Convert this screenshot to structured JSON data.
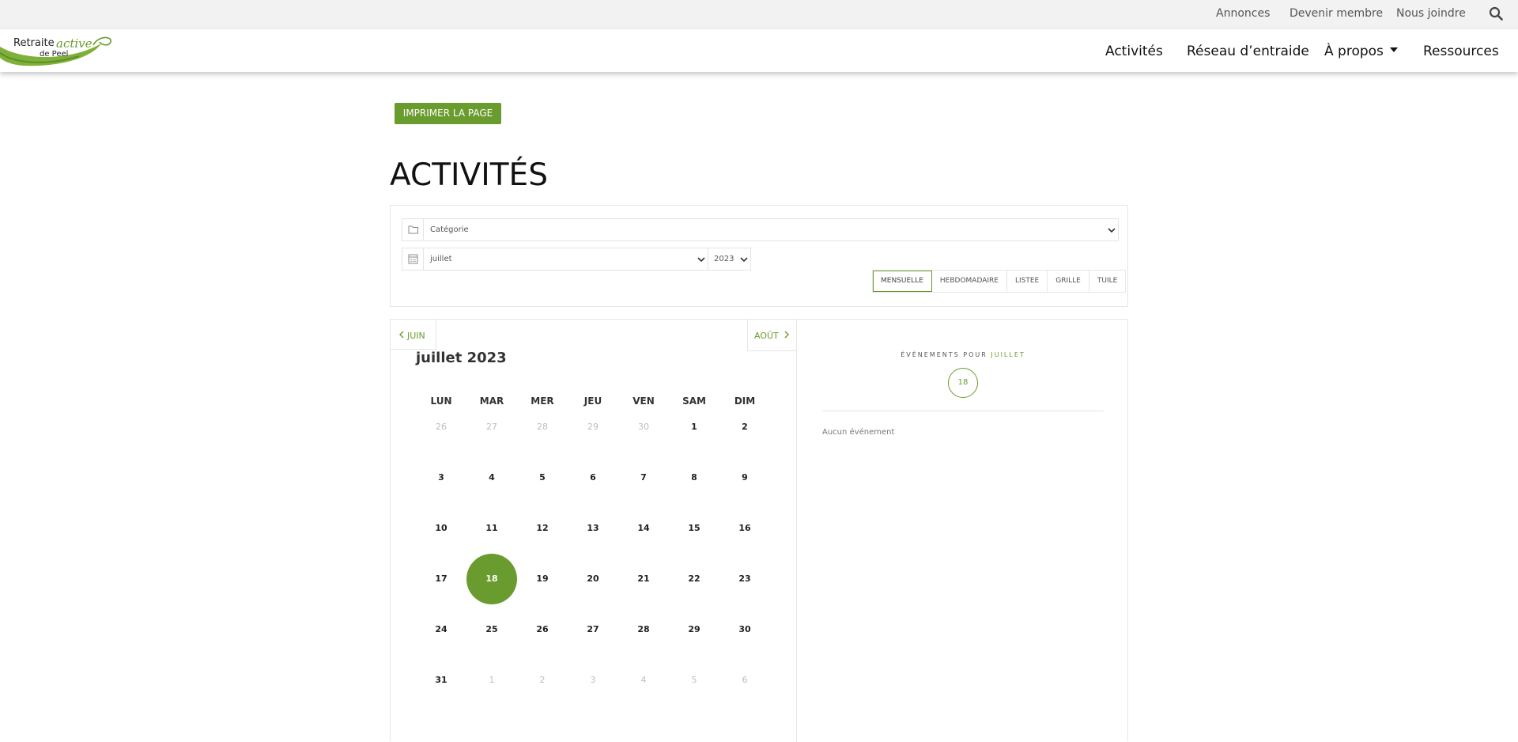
{
  "topbar": {
    "links": [
      "Annonces",
      "Devenir membre",
      "Nous joindre"
    ]
  },
  "logo": {
    "line1": "Retraite",
    "line2": "active",
    "line3": "de Peel"
  },
  "nav": {
    "items": [
      "Activités",
      "Réseau d’entraide",
      "À propos",
      "Ressources"
    ]
  },
  "print_label": "IMPRIMER LA PAGE",
  "page_title": "ACTIVITÉS",
  "filters": {
    "category": "Catégorie",
    "month": "juillet",
    "year": "2023"
  },
  "views": [
    "MENSUELLE",
    "HEBDOMADAIRE",
    "LISTEE",
    "GRILLE",
    "TUILE"
  ],
  "calendar": {
    "prev_label": "JUIN",
    "next_label": "AOÛT",
    "month_title": "juillet 2023",
    "weekdays": [
      "LUN",
      "MAR",
      "MER",
      "JEU",
      "VEN",
      "SAM",
      "DIM"
    ],
    "weeks": [
      [
        "26",
        "27",
        "28",
        "29",
        "30",
        "1",
        "2"
      ],
      [
        "3",
        "4",
        "5",
        "6",
        "7",
        "8",
        "9"
      ],
      [
        "10",
        "11",
        "12",
        "13",
        "14",
        "15",
        "16"
      ],
      [
        "17",
        "18",
        "19",
        "20",
        "21",
        "22",
        "23"
      ],
      [
        "24",
        "25",
        "26",
        "27",
        "28",
        "29",
        "30"
      ],
      [
        "31",
        "1",
        "2",
        "3",
        "4",
        "5",
        "6"
      ]
    ]
  },
  "events": {
    "heading_prefix": "ÉVÉNEMENTS POUR",
    "heading_month": "JUILLET",
    "selected_day": "18",
    "empty_text": "Aucun événement"
  },
  "colors": {
    "accent": "#6a9b2e"
  }
}
